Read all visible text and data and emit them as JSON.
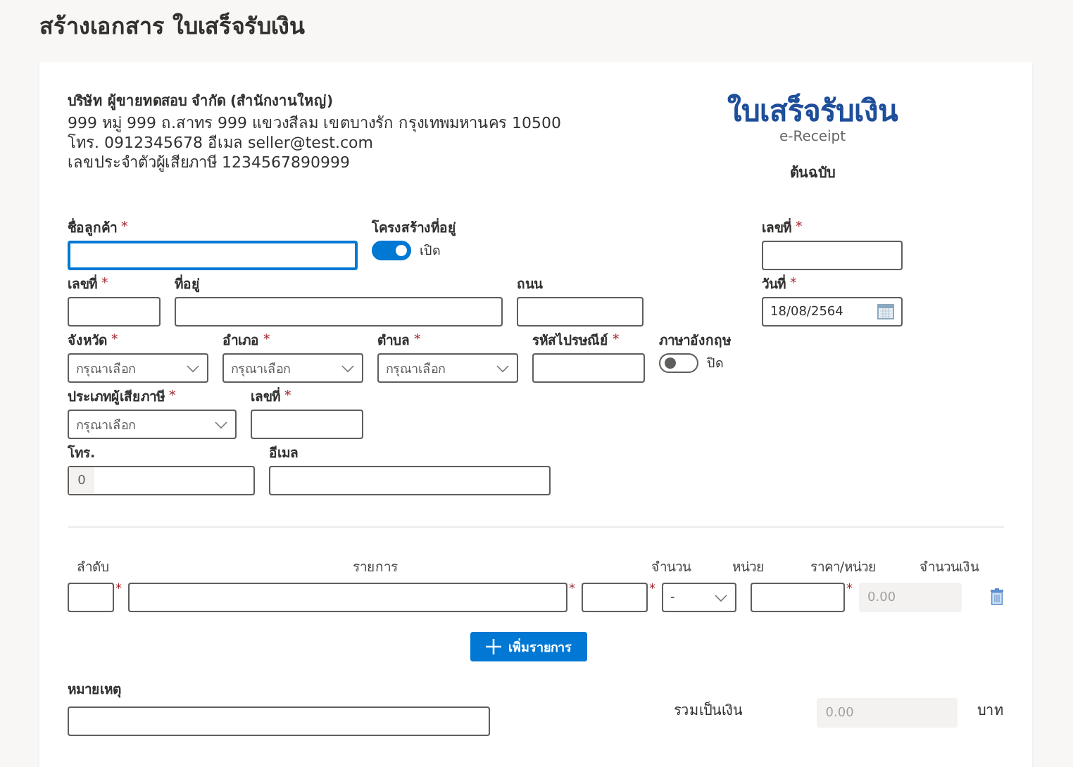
{
  "page_title": "สร้างเอกสาร ใบเสร็จรับเงิน",
  "seller": {
    "name": "บริษัท ผู้ขายทดสอบ จำกัด (สำนักงานใหญ่)",
    "address": "999 หมู่ 999 ถ.สาทร 999 แขวงสีลม เขตบางรัก กรุงเทพมหานคร 10500",
    "contact": "โทร. 0912345678 อีเมล seller@test.com",
    "tax_id": "เลขประจำตัวผู้เสียภาษี 1234567890999"
  },
  "document": {
    "title": "ใบเสร็จรับเงิน",
    "subtitle": "e-Receipt",
    "copy": "ต้นฉบับ"
  },
  "form_rows": [
    [
      {
        "kind": "text",
        "label": "ชื่อลูกค้า",
        "required_mark": "*",
        "focused": true
      },
      {
        "kind": "toggle",
        "label": "โครงสร้างที่อยู่",
        "on": true,
        "state_text": "เปิด"
      }
    ],
    [
      {
        "kind": "text",
        "label": "เลขที่",
        "required_mark": "*",
        "focused": false
      },
      {
        "kind": "text",
        "label": "ที่อยู่",
        "focused": false
      },
      {
        "kind": "text",
        "label": "ถนน",
        "focused": false
      }
    ],
    [
      {
        "kind": "select",
        "label": "จังหวัด",
        "required_mark": "*",
        "placeholder": "กรุณาเลือก"
      },
      {
        "kind": "select",
        "label": "อำเภอ",
        "required_mark": "*",
        "placeholder": "กรุณาเลือก"
      },
      {
        "kind": "select",
        "label": "ตำบล",
        "required_mark": "*",
        "placeholder": "กรุณาเลือก"
      },
      {
        "kind": "text",
        "label": "รหัสไปรษณีย์",
        "required_mark": "*",
        "focused": false
      },
      {
        "kind": "toggle",
        "label": "ภาษาอังกฤษ",
        "on": false,
        "state_text": "ปิด"
      }
    ],
    [
      {
        "kind": "select",
        "label": "ประเภทผู้เสียภาษี",
        "required_mark": "*",
        "placeholder": "กรุณาเลือก"
      },
      {
        "kind": "text",
        "label": "เลขที่",
        "required_mark": "*",
        "focused": false
      }
    ],
    [
      {
        "kind": "prefixed",
        "label": "โทร.",
        "prefix": "0"
      },
      {
        "kind": "text",
        "label": "อีเมล",
        "focused": false
      }
    ]
  ],
  "right_fields": [
    {
      "kind": "text",
      "label": "เลขที่",
      "required_mark": "*",
      "focused": false
    },
    {
      "kind": "date",
      "label": "วันที่",
      "required_mark": "*",
      "value": "18/08/2564"
    }
  ],
  "items": {
    "columns": [
      "ลำดับ",
      "รายการ",
      "จำนวน",
      "หน่วย",
      "ราคา/หน่วย",
      "จำนวนเงิน"
    ],
    "rows": [
      {
        "order_mark": "*",
        "description_mark": "*",
        "quantity_mark": "*",
        "unit": "-",
        "price_mark": "*",
        "amount": "0.00"
      }
    ],
    "add_button": "เพิ่มรายการ"
  },
  "notes": {
    "label": "หมายเหตุ"
  },
  "total": {
    "label": "รวมเป็นเงิน",
    "value": "0.00",
    "currency": "บาท"
  }
}
